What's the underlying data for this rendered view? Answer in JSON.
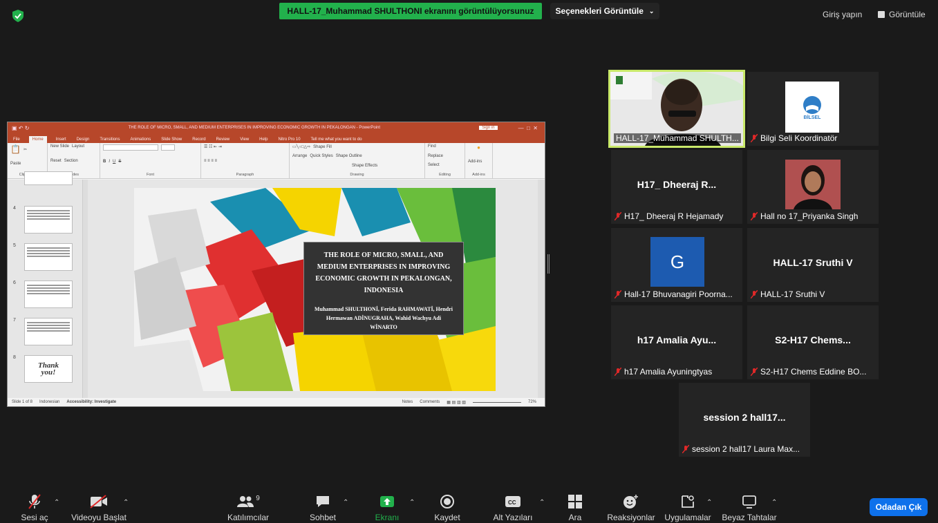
{
  "top_bar": {
    "share_banner": "HALL-17_Muhammad SHULTHONI ekranını görüntülüyorsunuz",
    "view_options": "Seçenekleri Görüntüle",
    "login": "Giriş yapın",
    "view": "Görüntüle"
  },
  "ppt": {
    "title": "THE ROLE OF MICRO, SMALL, AND MEDIUM ENTERPRISES IN IMPROVING ECONOMIC GROWTH IN PEKALONGAN - PowerPoint",
    "sign_in": "Sign in",
    "menu": [
      "File",
      "Home",
      "Insert",
      "Design",
      "Transitions",
      "Animations",
      "Slide Show",
      "Record",
      "Review",
      "View",
      "Help",
      "Nitro Pro 10",
      "Tell me what you want to do"
    ],
    "ribbon_groups": [
      "Clipboard",
      "Slides",
      "Font",
      "Paragraph",
      "Drawing",
      "Editing",
      "Add-ins"
    ],
    "ribbon_items": {
      "paste": "Paste",
      "new_slide": "New Slide",
      "layout": "Layout",
      "reset": "Reset",
      "section": "Section",
      "arrange": "Arrange",
      "quick_styles": "Quick Styles",
      "shape_fill": "Shape Fill",
      "shape_outline": "Shape Outline",
      "shape_effects": "Shape Effects",
      "find": "Find",
      "replace": "Replace",
      "select": "Select",
      "add_ins": "Add-ins"
    },
    "thumb_numbers": [
      "4",
      "5",
      "6",
      "7",
      "8"
    ],
    "thank_you": "Thank you!",
    "slide_title": "THE ROLE OF MICRO, SMALL, AND MEDIUM ENTERPRISES IN IMPROVING ECONOMIC GROWTH IN PEKALONGAN, INDONESIA",
    "slide_authors": "Muhammad SHULTHONİ, Ferida RAHMAWATİ, Hendri Hermawan ADİNUGRAHA, Wahid Wachyu Adi WİNARTO",
    "status": {
      "slide": "Slide 1 of 8",
      "language": "Indonesian",
      "accessibility": "Accessibility: Investigate",
      "notes": "Notes",
      "comments": "Comments",
      "zoom": "72%"
    }
  },
  "participants": [
    {
      "id": "shulthoni",
      "name": "HALL-17_Muhammad SHULTH...",
      "big": "",
      "muted": false
    },
    {
      "id": "bilgi",
      "name": "Bilgi Seli Koordinatör",
      "big": "",
      "muted": true,
      "logo": "BİLSEL"
    },
    {
      "id": "dheeraj",
      "name": "H17_ Dheeraj R Hejamady",
      "big": "H17_ Dheeraj R...",
      "muted": true
    },
    {
      "id": "priyanka",
      "name": "Hall no 17_Priyanka Singh",
      "big": "",
      "muted": true
    },
    {
      "id": "bhuvanagiri",
      "name": "Hall-17 Bhuvanagiri Poorna...",
      "big": "",
      "muted": true,
      "avatar_letter": "G"
    },
    {
      "id": "sruthi",
      "name": "HALL-17 Sruthi V",
      "big": "HALL-17 Sruthi V",
      "muted": true
    },
    {
      "id": "amalia",
      "name": "h17 Amalia Ayuningtyas",
      "big": "h17 Amalia Ayu...",
      "muted": true
    },
    {
      "id": "chems",
      "name": "S2-H17  Chems Eddine BO...",
      "big": "S2-H17  Chems...",
      "muted": true
    },
    {
      "id": "laura",
      "name": "session 2 hall17 Laura Max...",
      "big": "session 2 hall17...",
      "muted": true
    }
  ],
  "toolbar": {
    "unmute": "Sesi aç",
    "start_video": "Videoyu Başlat",
    "participants": "Katılımcılar",
    "participants_count": "9",
    "chat": "Sohbet",
    "share_screen": "Ekranı paylaş",
    "record": "Kaydet",
    "captions": "Alt Yazıları Göster",
    "breakout": "Ara Odalar",
    "reactions": "Reaksiyonlar",
    "apps": "Uygulamalar",
    "whiteboard": "Beyaz Tahtalar",
    "leave": "Odadan Çık"
  },
  "colors": {
    "share_green": "#22b14c",
    "ppt_red": "#b7472a",
    "active_speaker": "#c9e96a",
    "leave_blue": "#0e71eb",
    "mic_off_red": "#e02828"
  }
}
